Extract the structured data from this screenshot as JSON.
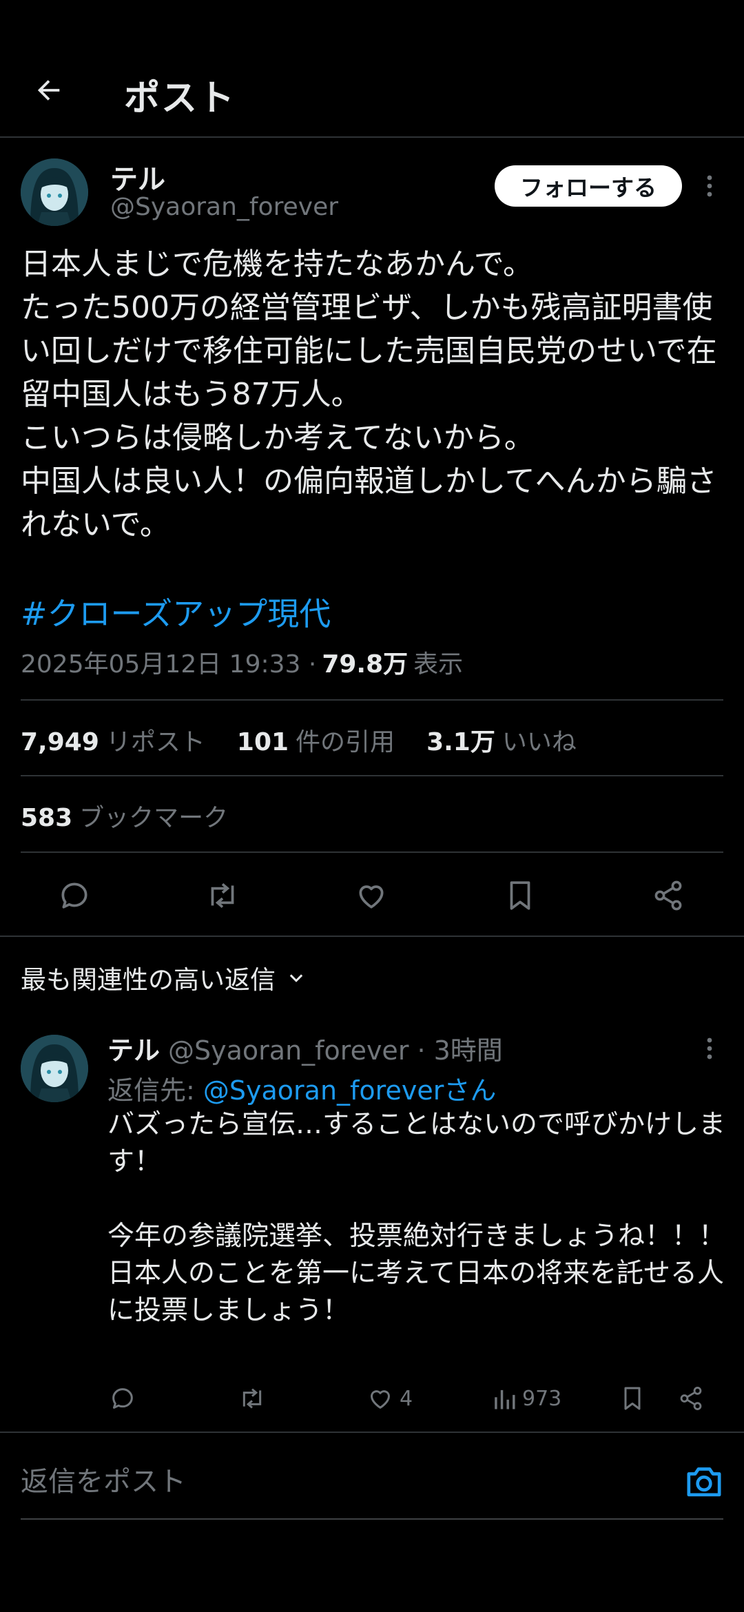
{
  "header": {
    "title": "ポスト"
  },
  "post": {
    "author_name": "テル",
    "author_handle": "@Syaoran_forever",
    "follow_label": "フォローする",
    "text": "日本人まじで危機を持たなあかんで。\nたった500万の経営管理ビザ、しかも残高証明書使い回しだけで移住可能にした売国自民党のせいで在留中国人はもう87万人。\nこいつらは侵略しか考えてないから。\n中国人は良い人！の偏向報道しかしてへんから騙されないで。",
    "hashtag": "#クローズアップ現代",
    "timestamp": "2025年05月12日 19:33 ·",
    "views_count": "79.8万",
    "views_label": "表示",
    "reposts_count": "7,949",
    "reposts_label": "リポスト",
    "quotes_count": "101",
    "quotes_label": "件の引用",
    "likes_count": "3.1万",
    "likes_label": "いいね",
    "bookmarks_count": "583",
    "bookmarks_label": "ブックマーク",
    "actions": [
      "reply-icon",
      "repost-icon",
      "like-icon",
      "bookmark-icon",
      "share-icon"
    ]
  },
  "sort": {
    "label": "最も関連性の高い返信"
  },
  "reply": {
    "author_name": "テル",
    "author_handle": "@Syaoran_forever",
    "time": "· 3時間",
    "reply_to_label": "返信先:",
    "reply_to_handle": "@Syaoran_foreverさん",
    "text": "バズったら宣伝…することはないので呼びかけします！\n\n今年の参議院選挙、投票絶対行きましょうね！！！\n日本人のことを第一に考えて日本の将来を託せる人に投票しましょう！",
    "likes": "4",
    "views": "973"
  },
  "composer": {
    "placeholder": "返信をポスト"
  },
  "colors": {
    "background": "#000000",
    "accent": "#1d9bf0",
    "muted": "#71767b",
    "divider": "#2f3336"
  }
}
